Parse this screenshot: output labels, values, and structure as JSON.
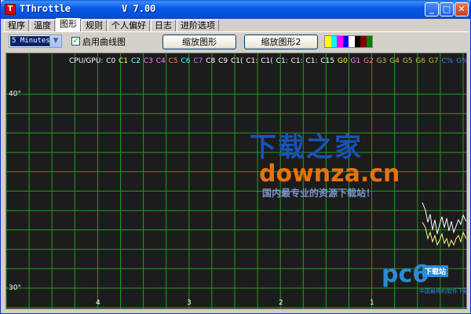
{
  "window": {
    "app_name": "TThrottle",
    "version": "V 7.00",
    "min_label": "_",
    "max_label": "□",
    "close_label": "✕",
    "icon_letter": "T"
  },
  "tabs": [
    "程序",
    "温度",
    "图形",
    "规则",
    "个人偏好",
    "日志",
    "进阶选项"
  ],
  "active_tab": "图形",
  "controls": {
    "time_range": "5 Minutes",
    "enable_curve_label": "启用曲线图",
    "enable_curve_checked": true,
    "check_mark": "✓",
    "dropdown_arrow": "▼",
    "zoom_button": "缩放图形",
    "zoom_button_2": "缩放图形2",
    "swatch_colors": [
      "#ffff00",
      "#00ffff",
      "#ff00ff",
      "#0000ff",
      "#ffffff",
      "#000000",
      "#800000",
      "#008000"
    ]
  },
  "graph": {
    "legend_prefix": "CPU/GPU:",
    "legend_items": [
      {
        "label": "C0",
        "color": "#ffffff"
      },
      {
        "label": "C1",
        "color": "#ffff80"
      },
      {
        "label": "C2",
        "color": "#80ffff"
      },
      {
        "label": "C3",
        "color": "#ff80ff"
      },
      {
        "label": "C4",
        "color": "#ff80ff"
      },
      {
        "label": "C5",
        "color": "#ff8040"
      },
      {
        "label": "C6",
        "color": "#40ffff"
      },
      {
        "label": "C7",
        "color": "#c080ff"
      },
      {
        "label": "C8",
        "color": "#ffffff"
      },
      {
        "label": "C9",
        "color": "#ffffff"
      },
      {
        "label": "C1(",
        "color": "#ffffff"
      },
      {
        "label": "C1:",
        "color": "#ffffff"
      },
      {
        "label": "C1(",
        "color": "#ffffff"
      },
      {
        "label": "C1:",
        "color": "#ffffff"
      },
      {
        "label": "C1:",
        "color": "#ffffff"
      },
      {
        "label": "C1:",
        "color": "#ffffff"
      },
      {
        "label": "C15",
        "color": "#ffffff"
      },
      {
        "label": "G0",
        "color": "#ffff40"
      },
      {
        "label": "G1",
        "color": "#ff80ff"
      },
      {
        "label": "G2",
        "color": "#ff8080"
      },
      {
        "label": "G3",
        "color": "#c0c040"
      },
      {
        "label": "G4",
        "color": "#c0c040"
      },
      {
        "label": "G5",
        "color": "#c0c040"
      },
      {
        "label": "G6",
        "color": "#c0c040"
      },
      {
        "label": "G7",
        "color": "#c0c040"
      },
      {
        "label": "C%",
        "color": "#4080ff"
      },
      {
        "label": "G%",
        "color": "#4080ff"
      }
    ],
    "y_labels": [
      "40°",
      "30°"
    ],
    "x_labels": [
      "4",
      "3",
      "2",
      "1"
    ],
    "grid_color": "#1f9e1f",
    "background": "#1c1c1c",
    "series_colors": [
      "#ffffff",
      "#ffff80"
    ]
  },
  "watermark": {
    "line1": "下载之家",
    "line2": "downza.cn",
    "line3": "国内最专业的资源下载站！",
    "pc6_logo": "pc6",
    "pc6_badge": "下载站",
    "pc6_sub": "中国最棒的软件下载站"
  }
}
